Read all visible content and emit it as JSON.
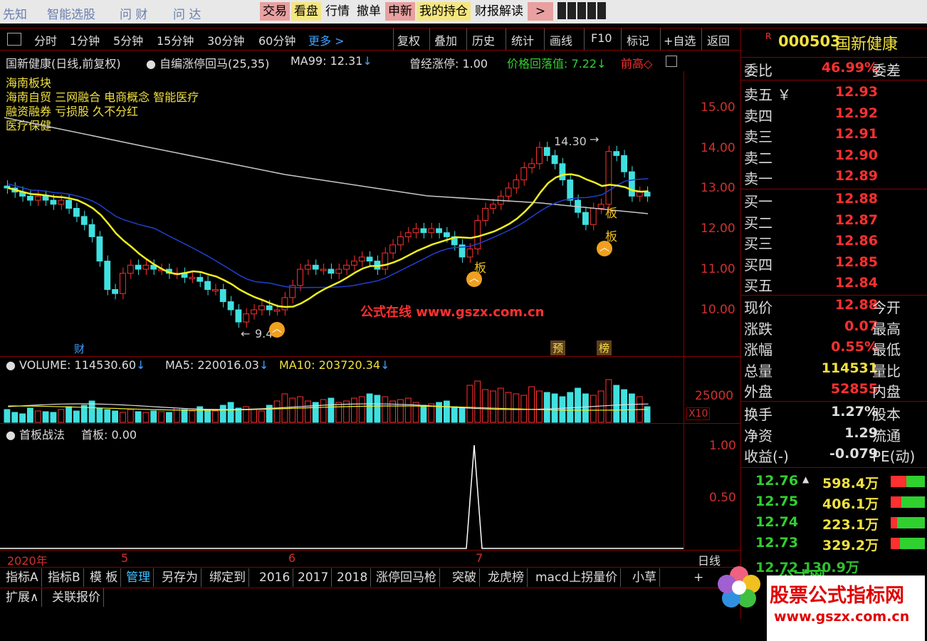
{
  "topbar": {
    "nav": [
      "先知",
      "智能选股",
      "问 财",
      "问 达"
    ],
    "buttons": [
      "交易",
      "看盘",
      "行情",
      "撤单",
      "申新",
      "我的持仓",
      "财报解读"
    ],
    "arrow_btn": ">"
  },
  "chart_toolbar": {
    "periods": [
      "分时",
      "1分钟",
      "5分钟",
      "15分钟",
      "30分钟",
      "60分钟"
    ],
    "more": "更多 >",
    "right_btns": [
      "复权",
      "叠加",
      "历史",
      "统计",
      "画线",
      "F10",
      "标记",
      "+自选",
      "返回"
    ]
  },
  "main_chart": {
    "title": "国新健康(日线,前复权)",
    "indicator": "自编涨停回马(25,35)",
    "ma99": "MA99: 12.31",
    "was_limit": "曾经涨停: 1.00",
    "pullback": "价格回落值: 7.22",
    "prev_high": "前高◇",
    "sectors": [
      "海南板块",
      "海南自贸 三网融合 电商概念 智能医疗",
      "融资融券 亏损股 久不分红",
      "医疗保健"
    ],
    "y_ticks": [
      "15.00",
      "14.00",
      "13.00",
      "12.00",
      "11.00",
      "10.00"
    ],
    "high_label": "14.30",
    "low_label": "9.4",
    "watermark": "公式在线 www.gszx.com.cn",
    "markers": {
      "cai": "财",
      "yu": "预",
      "bang": "榜",
      "ban1": "板",
      "ban2": "板",
      "ban3": "板"
    }
  },
  "volume": {
    "label": "VOLUME: 114530.60",
    "ma5": "MA5: 220016.03",
    "ma10": "MA10: 203720.34",
    "tick": "25000",
    "unit": "X10"
  },
  "indicator_panel": {
    "label": "首板战法",
    "value": "首板: 0.00",
    "ticks": [
      "1.00",
      "0.50"
    ]
  },
  "time_axis": {
    "year": "2020年",
    "months": [
      "5",
      "6",
      "7"
    ],
    "mode": "日线"
  },
  "bottom_tabs": [
    "指标A",
    "指标B",
    "模 板",
    "管理",
    "另存为",
    "绑定到",
    "2016",
    "2017",
    "2018",
    "涨停回马枪",
    "突破",
    "龙虎榜",
    "macd上拐量价",
    "小草"
  ],
  "bottom_tabs2": [
    "扩展∧",
    "关联报价"
  ],
  "plus": "+",
  "quote": {
    "code": "000503",
    "name": "国新健康",
    "wei_bi": {
      "label": "委比",
      "value": "46.99%",
      "right": "委差"
    },
    "sells": [
      {
        "label": "卖五",
        "price": "12.93"
      },
      {
        "label": "卖四",
        "price": "12.92"
      },
      {
        "label": "卖三",
        "price": "12.91"
      },
      {
        "label": "卖二",
        "price": "12.90"
      },
      {
        "label": "卖一",
        "price": "12.89"
      }
    ],
    "buys": [
      {
        "label": "买一",
        "price": "12.88"
      },
      {
        "label": "买二",
        "price": "12.87"
      },
      {
        "label": "买三",
        "price": "12.86"
      },
      {
        "label": "买四",
        "price": "12.85"
      },
      {
        "label": "买五",
        "price": "12.84"
      }
    ],
    "stats1": [
      {
        "label": "现价",
        "value": "12.88",
        "right": "今开",
        "color": "#ff3030"
      },
      {
        "label": "涨跌",
        "value": "0.07",
        "right": "最高",
        "color": "#ff3030"
      },
      {
        "label": "涨幅",
        "value": "0.55%",
        "right": "最低",
        "color": "#ff3030"
      },
      {
        "label": "总量",
        "value": "114531",
        "right": "量比",
        "color": "#f0e040"
      },
      {
        "label": "外盘",
        "value": "52855",
        "right": "内盘",
        "color": "#ff3030"
      }
    ],
    "stats2": [
      {
        "label": "换手",
        "value": "1.27%",
        "right": "股本"
      },
      {
        "label": "净资",
        "value": "1.29",
        "right": "流通"
      },
      {
        "label": "收益(-)",
        "value": "-0.079",
        "right": "PE(动)"
      }
    ],
    "depth": [
      {
        "price": "12.76",
        "amount": "598.4万",
        "fill": 0.45
      },
      {
        "price": "12.75",
        "amount": "406.1万",
        "fill": 0.32
      },
      {
        "price": "12.74",
        "amount": "223.1万",
        "fill": 0.18
      },
      {
        "price": "12.73",
        "amount": "329.2万",
        "fill": 0.27
      }
    ],
    "depth_tail": "12.72  130.9万"
  },
  "ad": {
    "line1": "股票公式指标网",
    "line2": "www.gszx.com.cn",
    "behind": "公式网"
  },
  "colors": {
    "up": "#ff3030",
    "down": "#40e0e0",
    "ma_yellow": "#f0f020",
    "ma_white": "#c8c8c8",
    "ma_blue": "#2040d0"
  }
}
